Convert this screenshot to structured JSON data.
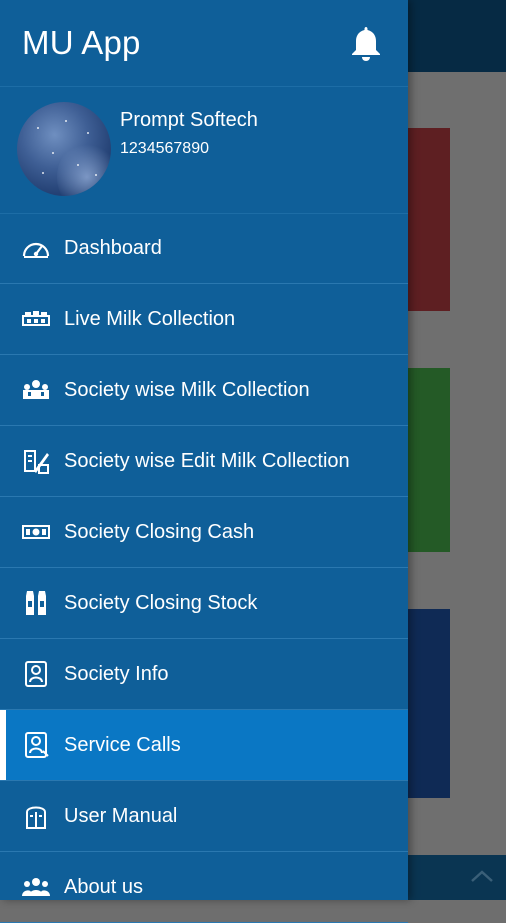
{
  "app": {
    "title": "MU App"
  },
  "user": {
    "name": "Prompt Softech",
    "phone": "1234567890"
  },
  "menu": {
    "items": [
      {
        "label": "Dashboard",
        "icon": "speedometer-icon"
      },
      {
        "label": "Live Milk Collection",
        "icon": "milk-collection-icon"
      },
      {
        "label": "Society wise Milk Collection",
        "icon": "group-milk-icon"
      },
      {
        "label": "Society wise Edit Milk Collection",
        "icon": "edit-collection-icon"
      },
      {
        "label": "Society Closing Cash",
        "icon": "cash-icon"
      },
      {
        "label": "Society Closing Stock",
        "icon": "stock-icon"
      },
      {
        "label": "Society Info",
        "icon": "info-icon"
      },
      {
        "label": "Service Calls",
        "icon": "service-call-icon",
        "active": true
      },
      {
        "label": "User Manual",
        "icon": "manual-icon"
      },
      {
        "label": "About us",
        "icon": "people-icon"
      }
    ]
  },
  "colors": {
    "drawer_bg": "#0f5f99",
    "active_item": "#0a77c4",
    "background_red_card": "#5e1f22",
    "background_green_card": "#245a26",
    "background_blue_card": "#0f2a55"
  }
}
